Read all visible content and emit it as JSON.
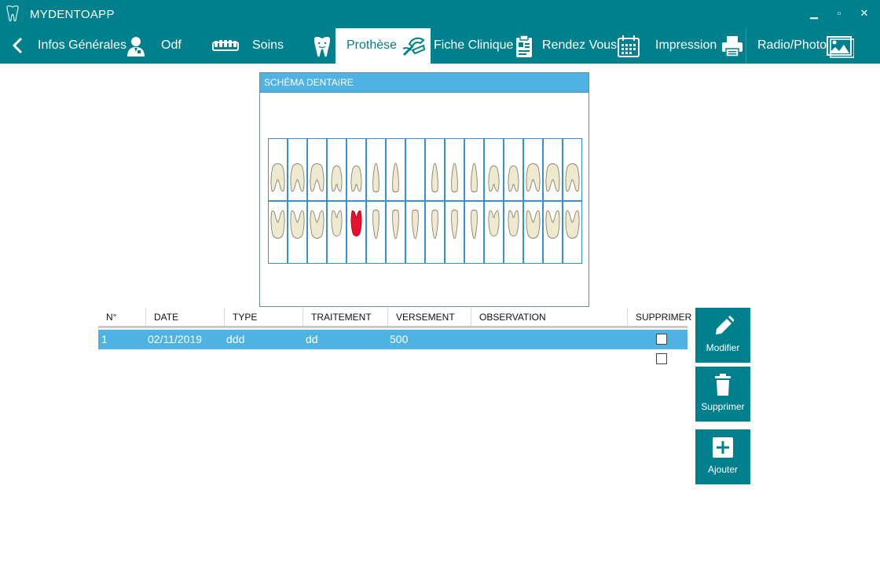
{
  "app": {
    "title": "MYDENTOAPP"
  },
  "window_controls": {
    "minimize": "▁",
    "maximize": "▫",
    "close": "✕"
  },
  "nav": {
    "tabs": [
      {
        "label": "Infos Générales",
        "icon": "doctor-icon"
      },
      {
        "label": "Odf",
        "icon": "braces-icon"
      },
      {
        "label": "Soins",
        "icon": "tooth-icon"
      },
      {
        "label": "Prothèse",
        "icon": "denture-icon",
        "active": true
      },
      {
        "label": "Fiche Clinique",
        "icon": "clipboard-icon"
      },
      {
        "label": "Rendez Vous",
        "icon": "calendar-icon"
      },
      {
        "label": "Impression",
        "icon": "printer-icon"
      },
      {
        "label": "Radio/Photo",
        "icon": "image-icon"
      }
    ]
  },
  "schema": {
    "title": "SCHÉMA DENTAIRE",
    "upper_teeth": 16,
    "lower_teeth": 16,
    "missing_upper_index": 7,
    "highlighted_lower_index": 4,
    "highlight_color": "#e8112d"
  },
  "table": {
    "columns": [
      "N°",
      "DATE",
      "TYPE",
      "TRAITEMENT",
      "VERSEMENT",
      "OBSERVATION",
      "SUPPRIMER"
    ],
    "rows": [
      {
        "n": "1",
        "date": "02/11/2019",
        "type": "ddd",
        "traitement": "dd",
        "versement": "500",
        "observation": "",
        "selected": true
      },
      {
        "n": "",
        "date": "",
        "type": "",
        "traitement": "",
        "versement": "",
        "observation": "",
        "selected": false
      }
    ]
  },
  "actions": {
    "modify": "Modifier",
    "delete": "Supprimer",
    "add": "Ajouter"
  },
  "colors": {
    "primary": "#00808d",
    "header_blue": "#4fb2e2",
    "selection": "#4fb2e2"
  }
}
